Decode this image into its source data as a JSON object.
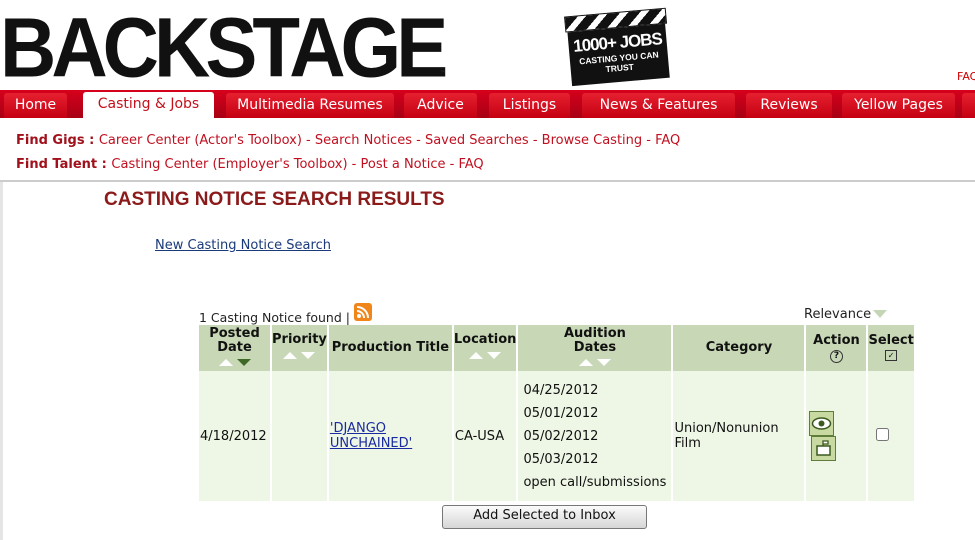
{
  "header": {
    "logo": "BACKSTAGE",
    "clapper_line1": "1000+ JOBS",
    "clapper_line2": "CASTING YOU CAN",
    "clapper_line3": "TRUST",
    "faq": "FAQ"
  },
  "nav": {
    "tabs": [
      {
        "label": "Home"
      },
      {
        "label": "Casting & Jobs"
      },
      {
        "label": "Multimedia Resumes"
      },
      {
        "label": "Advice"
      },
      {
        "label": "Listings"
      },
      {
        "label": "News & Features"
      },
      {
        "label": "Reviews"
      },
      {
        "label": "Yellow Pages"
      }
    ],
    "active": "Casting & Jobs"
  },
  "subnav": {
    "gigs_label": "Find Gigs",
    "gigs_links": [
      "Career Center (Actor's Toolbox)",
      "Search Notices",
      "Saved Searches",
      "Browse Casting",
      "FAQ"
    ],
    "talent_label": "Find Talent",
    "talent_links": [
      "Casting Center (Employer's Toolbox)",
      "Post a Notice",
      "FAQ"
    ]
  },
  "main": {
    "title": "CASTING NOTICE SEARCH RESULTS",
    "new_search": "New Casting Notice Search",
    "found_text": "1 Casting Notice found |",
    "sort_label": "Relevance"
  },
  "table": {
    "headers": {
      "posted": [
        "Posted",
        "Date"
      ],
      "priority": "Priority",
      "title": "Production Title",
      "location": "Location",
      "audition": [
        "Audition",
        "Dates"
      ],
      "category": "Category",
      "action": "Action",
      "select": "Select"
    },
    "rows": [
      {
        "posted": "4/18/2012",
        "priority": "",
        "title": "'DJANGO UNCHAINED'",
        "location": "CA-USA",
        "dates": [
          "04/25/2012",
          "05/01/2012",
          "05/02/2012",
          "05/03/2012",
          "open call/submissions"
        ],
        "category": "Union/Nonunion Film",
        "selected": false
      }
    ]
  },
  "footer": {
    "add_button": "Add Selected to Inbox"
  },
  "colors": {
    "brand_red": "#d6001c",
    "title_red": "#8b1a1a",
    "header_green": "#c8d8b6",
    "row_green": "#eef7e6"
  }
}
